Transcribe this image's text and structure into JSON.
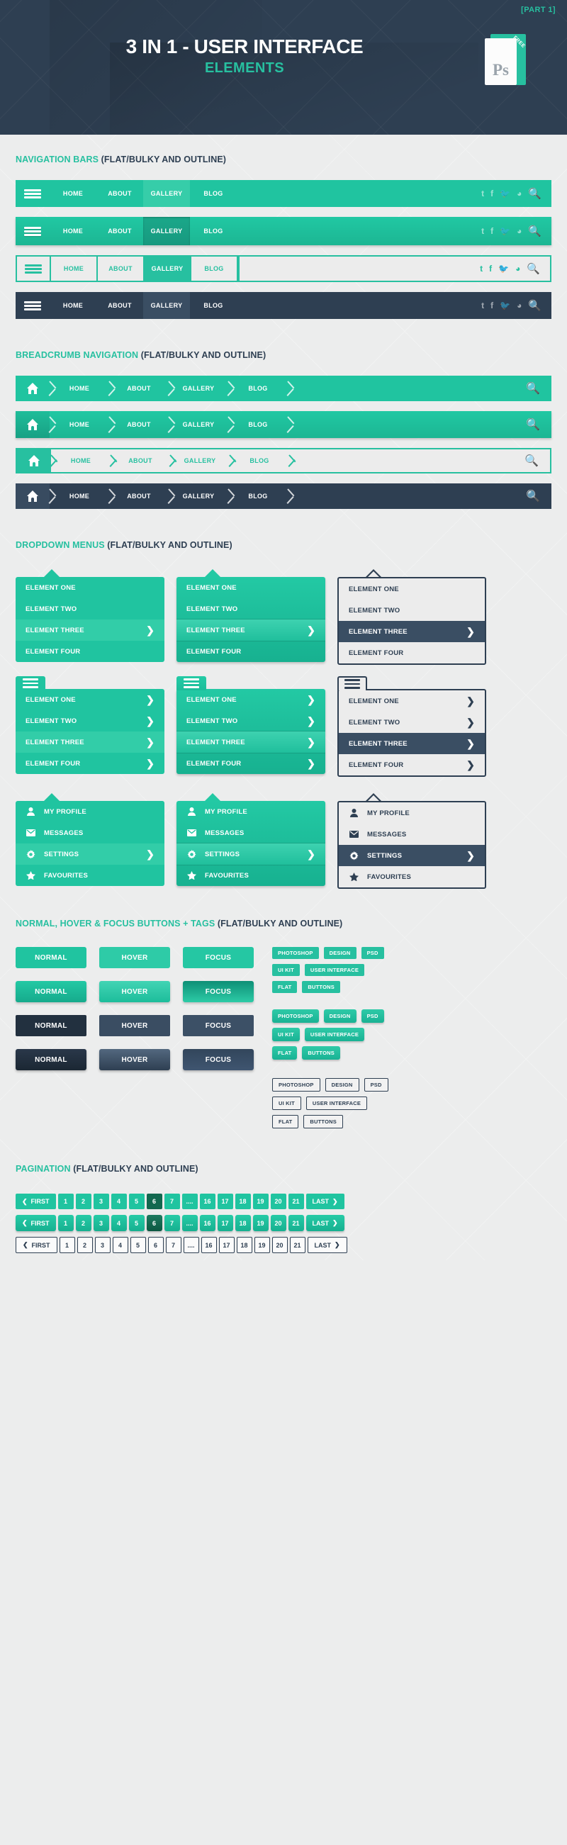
{
  "header": {
    "part_label": "[PART 1]",
    "title_line1": "3 IN 1 - USER INTERFACE",
    "title_line2": "ELEMENTS",
    "badge_text": "Ps",
    "badge_ribbon": "FREE"
  },
  "sections": {
    "nav": {
      "title_green": "NAVIGATION BARS",
      "title_dark": "(FLAT/BULKY AND OUTLINE)"
    },
    "breadcrumb": {
      "title_green": "BREADCRUMB NAVIGATION",
      "title_dark": "(FLAT/BULKY AND OUTLINE)"
    },
    "dropdown": {
      "title_green": "DROPDOWN MENUS",
      "title_dark": "(FLAT/BULKY AND OUTLINE)"
    },
    "buttons": {
      "title_green": "NORMAL, HOVER & FOCUS BUTTONS + TAGS",
      "title_dark": "(FLAT/BULKY AND OUTLINE)"
    },
    "pagination": {
      "title_green": "PAGINATION",
      "title_dark": "(FLAT/BULKY AND OUTLINE)"
    }
  },
  "navbar": {
    "items": [
      "HOME",
      "ABOUT",
      "GALLERY",
      "BLOG"
    ],
    "active_item": "GALLERY",
    "social": [
      "t",
      "f",
      "🐦",
      "ɑ"
    ],
    "search_icon": "search-icon",
    "menu_icon": "hamburger-icon"
  },
  "breadcrumbs": {
    "home_icon": "home-icon",
    "items": [
      "HOME",
      "ABOUT",
      "GALLERY",
      "BLOG"
    ],
    "search_icon": "search-icon"
  },
  "dropdowns": {
    "simple_items": [
      "ELEMENT ONE",
      "ELEMENT TWO",
      "ELEMENT THREE",
      "ELEMENT FOUR"
    ],
    "simple_active": "ELEMENT THREE",
    "arrow_items": [
      "ELEMENT ONE",
      "ELEMENT TWO",
      "ELEMENT THREE",
      "ELEMENT FOUR"
    ],
    "arrow_active": "ELEMENT THREE",
    "icon_items": [
      {
        "label": "MY PROFILE",
        "icon": "user-icon"
      },
      {
        "label": "MESSAGES",
        "icon": "envelope-icon"
      },
      {
        "label": "SETTINGS",
        "icon": "gear-icon"
      },
      {
        "label": "FAVOURITES",
        "icon": "star-icon"
      }
    ],
    "icon_active": "SETTINGS",
    "chevron": "❯"
  },
  "buttons": {
    "states": [
      "NORMAL",
      "HOVER",
      "FOCUS"
    ]
  },
  "tags": {
    "row1": [
      "PHOTOSHOP",
      "DESIGN",
      "PSD"
    ],
    "row2": [
      "UI KIT",
      "USER INTERFACE"
    ],
    "row3": [
      "FLAT",
      "BUTTONS"
    ]
  },
  "pagination": {
    "first_label": "FIRST",
    "last_label": "LAST",
    "prev_icon": "❮",
    "next_icon": "❯",
    "pages": [
      "1",
      "2",
      "3",
      "4",
      "5",
      "6",
      "7",
      "....",
      "16",
      "17",
      "18",
      "19",
      "20",
      "21"
    ],
    "current_page": "6"
  },
  "colors": {
    "accent_green": "#20c4a0",
    "dark_navy": "#2e3f52",
    "page_bg": "#eceded",
    "current_page_green": "#12684f"
  }
}
